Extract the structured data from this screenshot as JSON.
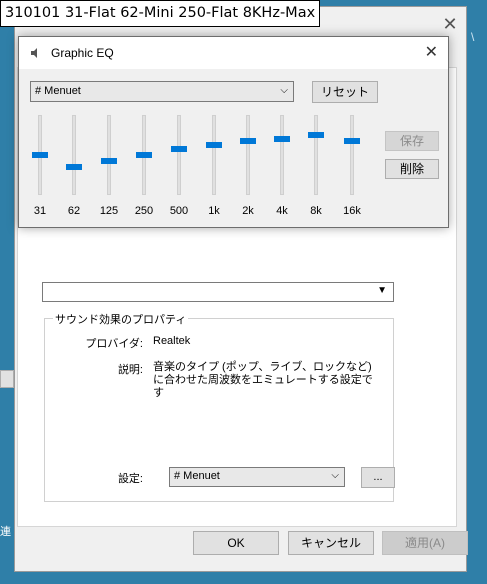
{
  "caption": "310101 31-Flat 62-Mini  250-Flat 8KHz-Max",
  "eq_dialog": {
    "title": "Graphic EQ",
    "close_glyph": "✕",
    "preset": "# Menuet",
    "reset_label": "リセット",
    "save_label": "保存",
    "delete_label": "削除",
    "bands": [
      {
        "freq": "31",
        "level": 0.5
      },
      {
        "freq": "62",
        "level": 0.35
      },
      {
        "freq": "125",
        "level": 0.43
      },
      {
        "freq": "250",
        "level": 0.5
      },
      {
        "freq": "500",
        "level": 0.57
      },
      {
        "freq": "1k",
        "level": 0.63
      },
      {
        "freq": "2k",
        "level": 0.67
      },
      {
        "freq": "4k",
        "level": 0.7
      },
      {
        "freq": "8k",
        "level": 0.75
      },
      {
        "freq": "16k",
        "level": 0.68
      }
    ]
  },
  "sound_properties": {
    "close_glyph": "✕",
    "group_title": "サウンド効果のプロパティ",
    "provider_label": "プロバイダ:",
    "provider_value": "Realtek",
    "description_label": "説明:",
    "description_value": "音楽のタイプ (ポップ、ライブ、ロックなど) に合わせた周波数をエミュレートする設定です",
    "setting_label": "設定:",
    "setting_value": "# Menuet",
    "more_label": "...",
    "ok_label": "OK",
    "cancel_label": "キャンセル",
    "apply_label": "適用(A)"
  },
  "left_strip_text": "連",
  "right_edge_mark": "\\",
  "icons": {
    "eq_title_icon": "speaker-icon",
    "dropdown_arrow": "chevron-down-icon"
  },
  "colors": {
    "slider_thumb": "#0078d7",
    "desktop": "#2f7fa8"
  }
}
